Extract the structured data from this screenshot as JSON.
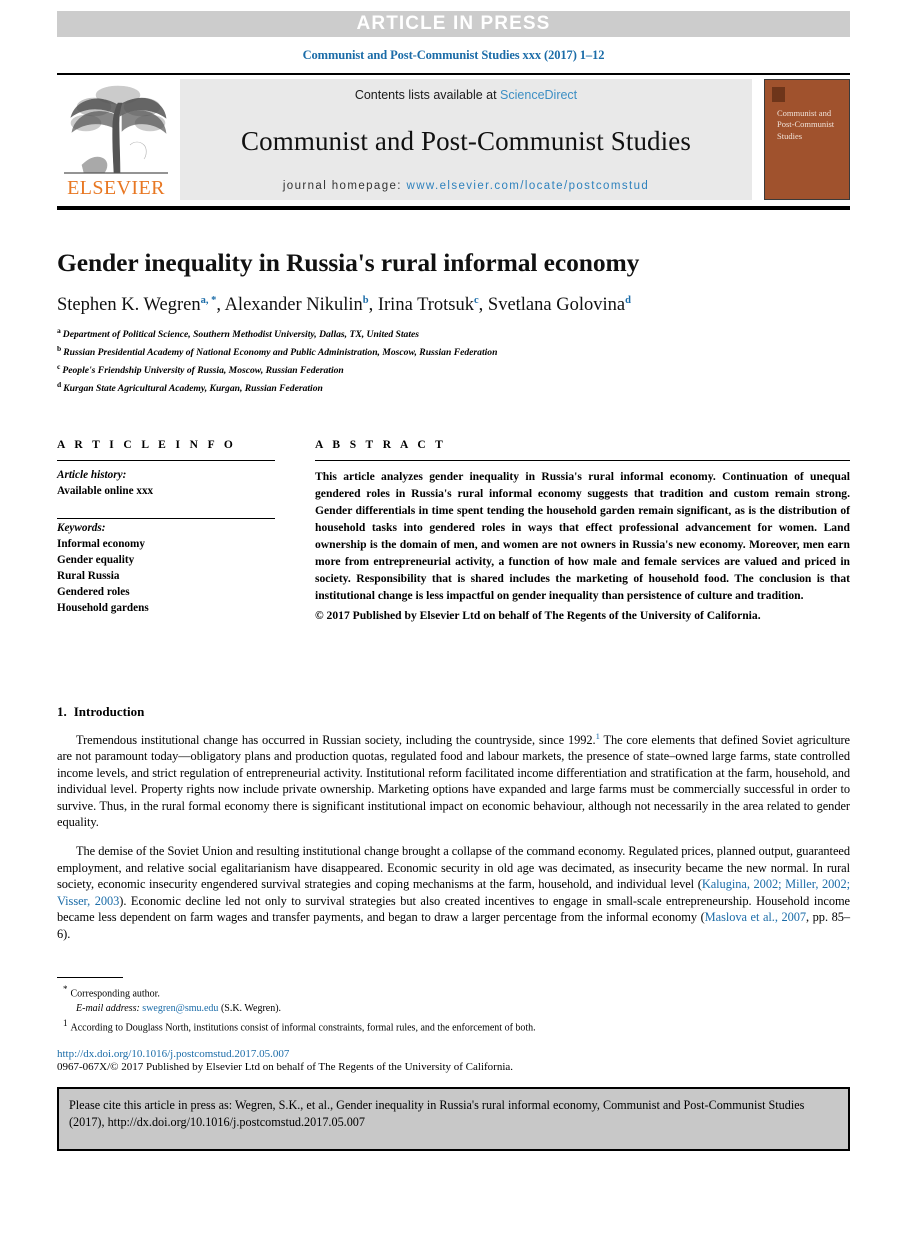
{
  "banner": {
    "text": "ARTICLE IN PRESS"
  },
  "running_head": {
    "text": "Communist and Post-Communist Studies xxx (2017) 1–12"
  },
  "journal_header": {
    "contents_prefix": "Contents lists available at ",
    "sciencedirect_link": "ScienceDirect",
    "journal_title": "Communist and Post-Communist Studies",
    "homepage_label": "journal homepage: ",
    "homepage_url": "www.elsevier.com/locate/postcomstud",
    "publisher_wordmark": "ELSEVIER",
    "cover_title": "Communist and Post-Communist Studies",
    "accent_orange": "#e87722",
    "link_blue": "#3d8fc4",
    "cover_brown": "#a0522d",
    "banner_grey": "#cccccc"
  },
  "article": {
    "title": "Gender inequality in Russia's rural informal economy",
    "authors": [
      {
        "name": "Stephen K. Wegren",
        "marks": "a, *"
      },
      {
        "name": "Alexander Nikulin",
        "marks": "b"
      },
      {
        "name": "Irina Trotsuk",
        "marks": "c"
      },
      {
        "name": "Svetlana Golovina",
        "marks": "d"
      }
    ],
    "affiliations": [
      {
        "mark": "a",
        "text": "Department of Political Science, Southern Methodist University, Dallas, TX, United States"
      },
      {
        "mark": "b",
        "text": "Russian Presidential Academy of National Economy and Public Administration, Moscow, Russian Federation"
      },
      {
        "mark": "c",
        "text": "People's Friendship University of Russia, Moscow, Russian Federation"
      },
      {
        "mark": "d",
        "text": "Kurgan State Agricultural Academy, Kurgan, Russian Federation"
      }
    ]
  },
  "article_info": {
    "label": "A R T I C L E  I N F O",
    "history_label": "Article history:",
    "history_value": "Available online xxx",
    "keywords_label": "Keywords:",
    "keywords": [
      "Informal economy",
      "Gender equality",
      "Rural Russia",
      "Gendered roles",
      "Household gardens"
    ]
  },
  "abstract": {
    "label": "A B S T R A C T",
    "body": "This article analyzes gender inequality in Russia's rural informal economy. Continuation of unequal gendered roles in Russia's rural informal economy suggests that tradition and custom remain strong. Gender differentials in time spent tending the household garden remain significant, as is the distribution of household tasks into gendered roles in ways that effect professional advancement for women. Land ownership is the domain of men, and women are not owners in Russia's new economy. Moreover, men earn more from entrepreneurial activity, a function of how male and female services are valued and priced in society. Responsibility that is shared includes the marketing of household food. The conclusion is that institutional change is less impactful on gender inequality than persistence of culture and tradition.",
    "copyright": "© 2017 Published by Elsevier Ltd on behalf of The Regents of the University of California."
  },
  "introduction": {
    "number": "1.",
    "heading": "Introduction",
    "paragraph1_a": "Tremendous institutional change has occurred in Russian society, including the countryside, since 1992.",
    "paragraph1_fnref": "1",
    "paragraph1_b": " The core elements that defined Soviet agriculture are not paramount today—obligatory plans and production quotas, regulated food and labour markets, the presence of state–owned large farms, state controlled income levels, and strict regulation of entrepreneurial activity. Institutional reform facilitated income differentiation and stratification at the farm, household, and individual level. Property rights now include private ownership. Marketing options have expanded and large farms must be commercially successful in order to survive. Thus, in the rural formal economy there is significant institutional impact on economic behaviour, although not necessarily in the area related to gender equality.",
    "paragraph2_a": "The demise of the Soviet Union and resulting institutional change brought a collapse of the command economy. Regulated prices, planned output, guaranteed employment, and relative social egalitarianism have disappeared. Economic security in old age was decimated, as insecurity became the new normal. In rural society, economic insecurity engendered survival strategies and coping mechanisms at the farm, household, and individual level (",
    "paragraph2_cite1": "Kalugina, 2002; Miller, 2002; Visser, 2003",
    "paragraph2_b": "). Economic decline led not only to survival strategies but also created incentives to engage in small-scale entrepreneurship. Household income became less dependent on farm wages and transfer payments, and began to draw a larger percentage from the informal economy (",
    "paragraph2_cite2": "Maslova et al., 2007",
    "paragraph2_c": ", pp. 85–6)."
  },
  "footnotes": {
    "corresponding": "Corresponding author.",
    "email_label": "E-mail address: ",
    "email": "swegren@smu.edu",
    "email_suffix": " (S.K. Wegren).",
    "note1_mark": "1",
    "note1": "According to Douglass North, institutions consist of informal constraints, formal rules, and the enforcement of both."
  },
  "footer": {
    "doi": "http://dx.doi.org/10.1016/j.postcomstud.2017.05.007",
    "issn_line": "0967-067X/© 2017 Published by Elsevier Ltd on behalf of The Regents of the University of California."
  },
  "cite_box": {
    "text": "Please cite this article in press as: Wegren, S.K., et al., Gender inequality in Russia's rural informal economy, Communist and Post-Communist Studies (2017), http://dx.doi.org/10.1016/j.postcomstud.2017.05.007"
  }
}
